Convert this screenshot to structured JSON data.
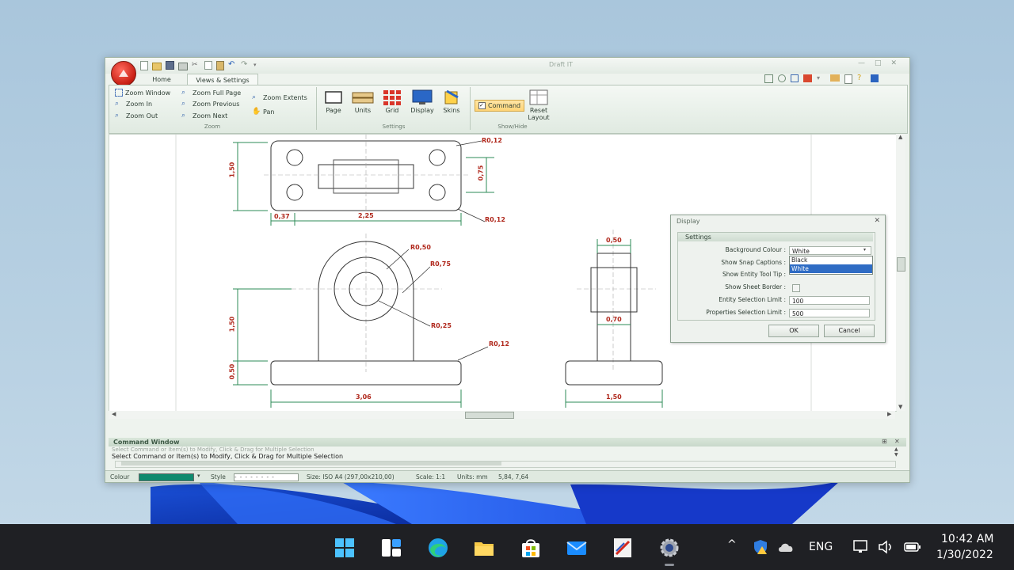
{
  "app": {
    "title": "Draft IT",
    "tabs": [
      "Home",
      "Views & Settings"
    ],
    "active_tab": "Views & Settings"
  },
  "ribbon": {
    "zoom_group": {
      "label": "Zoom",
      "items": [
        "Zoom Window",
        "Zoom Full Page",
        "Zoom Extents",
        "Zoom In",
        "Zoom Previous",
        "Pan",
        "Zoom Out",
        "Zoom Next"
      ]
    },
    "settings_group": {
      "label": "Settings",
      "items": [
        "Page",
        "Units",
        "Grid",
        "Display",
        "Skins"
      ]
    },
    "showhide_group": {
      "label": "Show/Hide",
      "items": [
        "Command",
        "Reset Layout"
      ]
    }
  },
  "drawing": {
    "dimensions": [
      "1,50",
      "0,75",
      "0,37",
      "2,25",
      "R0,12",
      "R0,12",
      "R0,50",
      "R0,75",
      "R0,25",
      "R0,12",
      "1,50",
      "0,50",
      "3,06",
      "0,50",
      "0,70",
      "1,50"
    ]
  },
  "dialog": {
    "title": "Display",
    "section": "Settings",
    "fields": {
      "background_colour_label": "Background Colour :",
      "background_colour_value": "White",
      "dropdown_options": [
        "Black",
        "White"
      ],
      "snap_captions_label": "Show Snap Captions :",
      "entity_tooltip_label": "Show Entity Tool Tip :",
      "sheet_border_label": "Show Sheet Border :",
      "selection_limit_label": "Entity Selection Limit :",
      "selection_limit_value": "100",
      "properties_limit_label": "Properties Selection Limit :",
      "properties_limit_value": "500"
    },
    "ok": "OK",
    "cancel": "Cancel"
  },
  "command_window": {
    "title": "Command Window",
    "history_line": "Select Command or Item(s) to Modify, Click & Drag for Multiple Selection",
    "current_line": "Select Command or Item(s) to Modify, Click & Drag for Multiple Selection"
  },
  "statusbar": {
    "colour_label": "Colour",
    "style_label": "Style",
    "size": "Size: ISO A4 (297,00x210,00)",
    "scale": "Scale: 1:1",
    "units": "Units: mm",
    "coords": "5,84, 7,64",
    "colour_swatch": "#0f8a6e"
  },
  "taskbar": {
    "language": "ENG",
    "time": "10:42 AM",
    "date": "1/30/2022",
    "icons": [
      "windows-start-icon",
      "widgets-icon",
      "edge-browser-icon",
      "file-explorer-icon",
      "microsoft-store-icon",
      "mail-icon",
      "draft-it-app-icon",
      "settings-icon"
    ]
  }
}
